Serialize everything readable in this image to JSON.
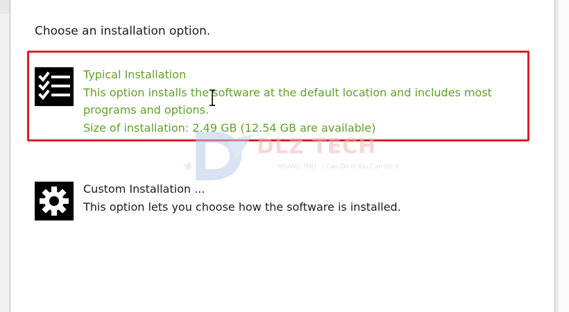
{
  "prompt": "Choose an installation option.",
  "options": [
    {
      "title": "Typical Installation",
      "description": "This option installs the software at the default location and includes most programs and options.",
      "size": "Size of installation: 2.49 GB (12.54 GB are available)",
      "icon": "checklist-icon",
      "selected": true
    },
    {
      "title": "Custom Installation ...",
      "description": "This option lets you choose how the software is installed.",
      "icon": "gear-icon",
      "selected": false
    }
  ],
  "watermark": {
    "text": "DLZ TECH HOANG THO Technology I Can Do It You Can Do It"
  },
  "colors": {
    "selected_text": "#62a028",
    "selection_border": "#d91f2b",
    "normal_text": "#1b1b1b",
    "icon_bg": "#000000"
  }
}
